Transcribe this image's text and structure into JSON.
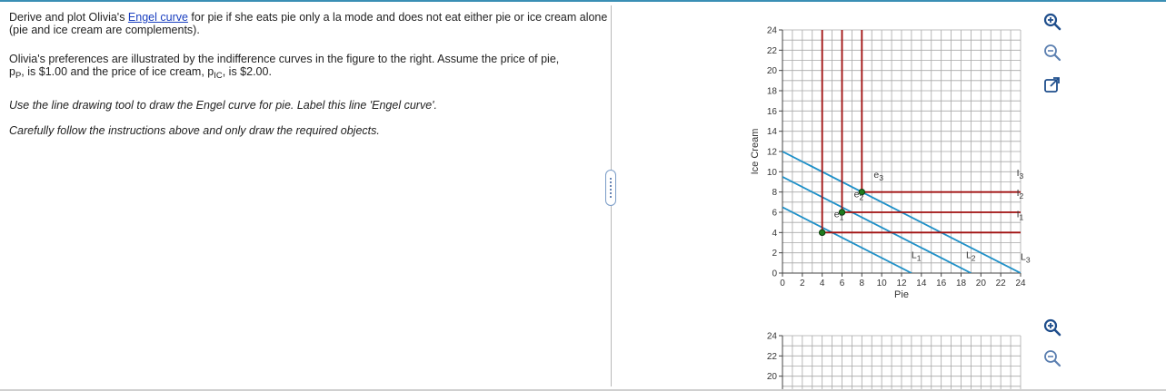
{
  "question": {
    "p1": {
      "before": "Derive and plot Olivia's ",
      "link": "Engel curve",
      "after": " for pie if she eats pie only a la mode and does not eat either pie or ice cream alone (pie and ice cream are complements)."
    },
    "p2": {
      "line1": "Olivia's preferences are illustrated by the indifference curves in the figure to the right.  Assume the price of pie,",
      "pp_sym": "p",
      "pp_sub": "P",
      "pp_text": ", is $1.00 and the price of ice cream, ",
      "pic_sym": "p",
      "pic_sub": "IC",
      "pic_text": ", is $2.00."
    },
    "p3": "Use the line drawing tool to draw the Engel curve for pie. Label this line 'Engel curve'.",
    "p4": "Carefully follow the instructions above and only draw the required objects."
  },
  "tools": {
    "zoom_in": "zoom-in-icon",
    "zoom_out": "zoom-out-icon",
    "popout": "popout-icon"
  },
  "colors": {
    "budget": "#1e90c8",
    "indifference": "#a01010",
    "point": "#1f7a1f",
    "grid": "#a8a8a8",
    "link": "#1a3fc0"
  },
  "chart_data": [
    {
      "type": "line",
      "xlabel": "Pie",
      "ylabel": "Ice Cream",
      "xlim": [
        0,
        24
      ],
      "ylim": [
        0,
        24
      ],
      "x_ticks": [
        0,
        2,
        4,
        6,
        8,
        10,
        12,
        14,
        16,
        18,
        20,
        22,
        24
      ],
      "y_ticks": [
        0,
        2,
        4,
        6,
        8,
        10,
        12,
        14,
        16,
        18,
        20,
        22,
        24
      ],
      "grid": true,
      "budget_lines": [
        {
          "name": "L1",
          "points": [
            [
              0,
              12
            ],
            [
              24,
              0
            ]
          ],
          "label_at": [
            13,
            1.5
          ]
        },
        {
          "name": "L2",
          "points": [
            [
              0,
              9.5
            ],
            [
              19,
              0
            ]
          ],
          "label_at": [
            18.5,
            1.5
          ]
        },
        {
          "name": "L3",
          "points": [
            [
              0,
              6.5
            ],
            [
              13,
              0
            ]
          ],
          "label_at": [
            24,
            1.3
          ]
        }
      ],
      "indifference_curves": [
        {
          "name": "I1",
          "corner": [
            4,
            4
          ],
          "label_at": [
            23.6,
            5.5
          ]
        },
        {
          "name": "I2",
          "corner": [
            6,
            6
          ],
          "label_at": [
            23.6,
            7.6
          ]
        },
        {
          "name": "I3",
          "corner": [
            8,
            8
          ],
          "label_at": [
            23.6,
            9.6
          ]
        }
      ],
      "points": [
        {
          "name": "e1",
          "x": 4,
          "y": 4,
          "label_at": [
            5.2,
            5.5
          ]
        },
        {
          "name": "e2",
          "x": 6,
          "y": 6,
          "label_at": [
            7.2,
            7.5
          ]
        },
        {
          "name": "e3",
          "x": 8,
          "y": 8,
          "label_at": [
            9.2,
            9.4
          ]
        }
      ]
    },
    {
      "type": "line",
      "xlim": [
        0,
        24
      ],
      "ylim": [
        0,
        24
      ],
      "y_ticks": [
        20,
        22,
        24
      ],
      "grid": true
    }
  ]
}
